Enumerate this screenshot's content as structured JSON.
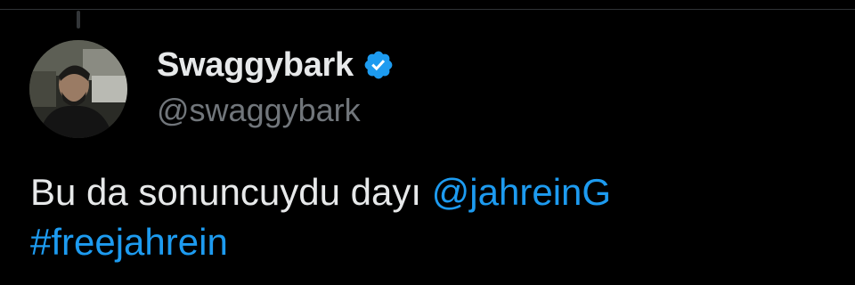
{
  "tweet": {
    "author": {
      "display_name": "Swaggybark",
      "handle": "@swaggybark",
      "verified": true
    },
    "text": "Bu da sonuncuydu dayı",
    "mention": "@jahreinG",
    "hashtag": "#freejahrein"
  },
  "colors": {
    "background": "#000000",
    "text_primary": "#e7e9ea",
    "text_secondary": "#71767b",
    "accent": "#1d9bf0"
  },
  "icons": {
    "verified": "verified-badge-icon"
  }
}
